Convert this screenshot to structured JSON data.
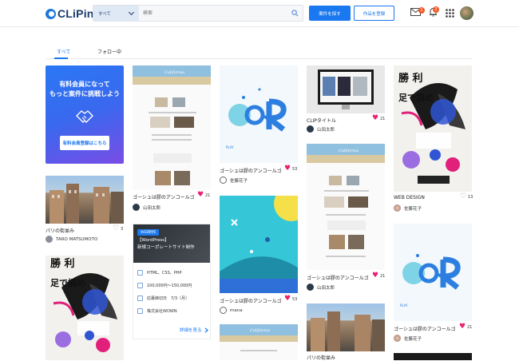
{
  "header": {
    "logo_text": "CLiPin",
    "search_category": "すべて",
    "search_placeholder": "検索",
    "find_job_label": "案件を探す",
    "register_work_label": "作品を登録",
    "mail_badge": "1",
    "bell_badge": "2"
  },
  "tabs": [
    {
      "label": "すべて",
      "active": true
    },
    {
      "label": "フォロー中",
      "active": false
    }
  ],
  "promo": {
    "line1": "有料会員になって",
    "line2": "もっと案件に挑戦しよう",
    "button": "有料会員登録はこちら"
  },
  "job": {
    "tag": "WEB制作",
    "title_line1": "【WordPress】",
    "title_line2": "新規コーポレートサイト制作",
    "skills": "HTML、CSS、PHP",
    "budget": "100,000円〜150,000円",
    "deadline": "応募締切日　7/3（月）",
    "company": "株式会社WOWN",
    "link": "詳細を見る"
  },
  "cards": {
    "paris1": {
      "title": "パリの街並み",
      "likes": "3",
      "author": "TARO MATSUMOTO"
    },
    "gosha1": {
      "title": "ゴーシュは膠のアンコールゴ...",
      "likes": "21",
      "author": "山田太郎"
    },
    "gosha2": {
      "title": "ゴーシュは膠のアンコールゴ...",
      "likes": "53",
      "author": "佐藤花子"
    },
    "gosha3": {
      "title": "ゴーシュは膠のアンコールゴ...",
      "likes": "53",
      "author": "mana"
    },
    "clip": {
      "title": "CLIPタイトル",
      "likes": "21",
      "author": "山田太郎"
    },
    "gosha4": {
      "title": "ゴーシュは膠のアンコールゴ...",
      "likes": "21",
      "author": "山田太郎"
    },
    "paris2": {
      "title": "パリの街並み",
      "likes": "",
      "author": ""
    },
    "webdesign": {
      "title": "WEB DESIGN",
      "likes": "13",
      "author": "佐藤花子"
    },
    "gosha5": {
      "title": "ゴーシュは膠のアンコールゴ...",
      "likes": "21",
      "author": "佐藤花子"
    }
  }
}
